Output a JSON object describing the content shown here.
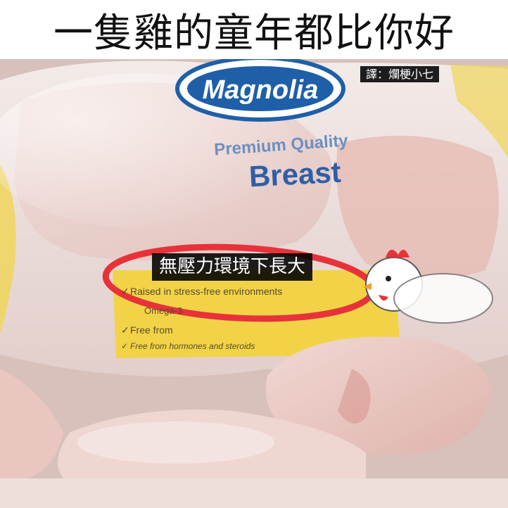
{
  "meme": {
    "headline": "一隻雞的童年都比你好",
    "translator_credit": "譯：爛梗小七",
    "caption": "無壓力環境下長大"
  },
  "package": {
    "brand": "Magnolia",
    "tagline": "Premium Quality",
    "product": "Breast",
    "claims": [
      "Raised in stress-free environments",
      "Omega-3",
      "Free from",
      "Free from hormones and steroids"
    ]
  },
  "colors": {
    "brand_blue": "#1f5fa8",
    "highlight_red": "#e8323a",
    "label_yellow": "#f3d23c",
    "meat_pink": "#e8c6c3"
  }
}
